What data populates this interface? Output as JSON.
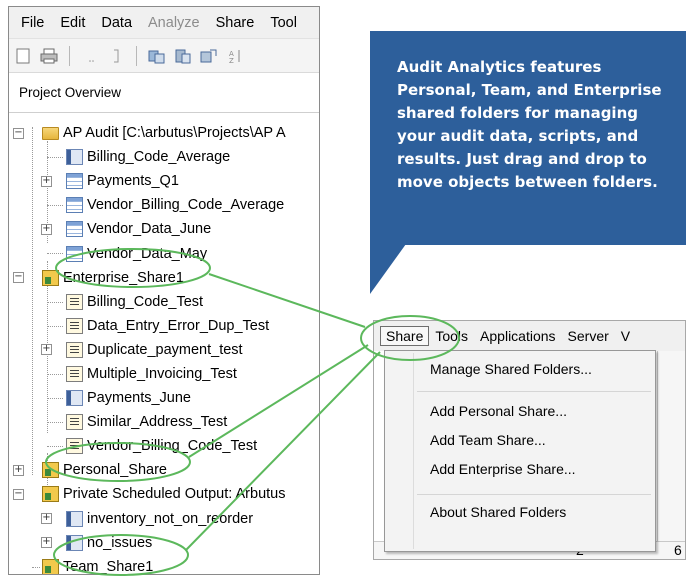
{
  "menu": {
    "file": "File",
    "edit": "Edit",
    "data": "Data",
    "analyze": "Analyze",
    "share": "Share",
    "tools": "Tool"
  },
  "toolbar": {
    "icons": [
      "new-icon",
      "print-icon",
      "separator-icon",
      "bracket-icon",
      "copy-icon",
      "paste-icon",
      "sort-icon"
    ]
  },
  "project_pane": {
    "title": "Project Overview"
  },
  "tree": {
    "ap_audit": "AP Audit [C:\\arbutus\\Projects\\AP A",
    "billing_code_average": "Billing_Code_Average",
    "payments_q1": "Payments_Q1",
    "vendor_billing_code_average": "Vendor_Billing_Code_Average",
    "vendor_data_june": "Vendor_Data_June",
    "vendor_data_may": "Vendor_Data_May",
    "enterprise_share1": "Enterprise_Share1",
    "billing_code_test": "Billing_Code_Test",
    "data_entry_error_dup_test": "Data_Entry_Error_Dup_Test",
    "duplicate_payment_test": "Duplicate_payment_test",
    "multiple_invoicing_test": "Multiple_Invoicing_Test",
    "payments_june": "Payments_June",
    "similar_address_test": "Similar_Address_Test",
    "vendor_billing_code_test": "Vendor_Billing_Code_Test",
    "personal_share": "Personal_Share",
    "private_scheduled_output": "Private Scheduled Output: Arbutus",
    "inventory_not_on_reorder": "inventory_not_on_reorder",
    "no_issues": "no_issues",
    "team_share1": "Team_Share1"
  },
  "callout": {
    "text": "Audit Analytics features Personal, Team, and Enterprise shared folders for managing your audit data, scripts, and results. Just drag and drop to move objects between folders."
  },
  "share_menu": {
    "bar_share": "Share",
    "bar_tools": "Tools",
    "bar_applications": "Applications",
    "bar_server": "Server",
    "bar_more": "V",
    "manage": "Manage Shared Folders...",
    "add_personal": "Add Personal Share...",
    "add_team": "Add Team Share...",
    "add_enterprise": "Add Enterprise Share...",
    "about": "About Shared Folders",
    "grid_value": "2",
    "grid_value_right": "6"
  },
  "colors": {
    "callout_bg": "#2d5f9b",
    "annotation_green": "#5cb85c"
  }
}
